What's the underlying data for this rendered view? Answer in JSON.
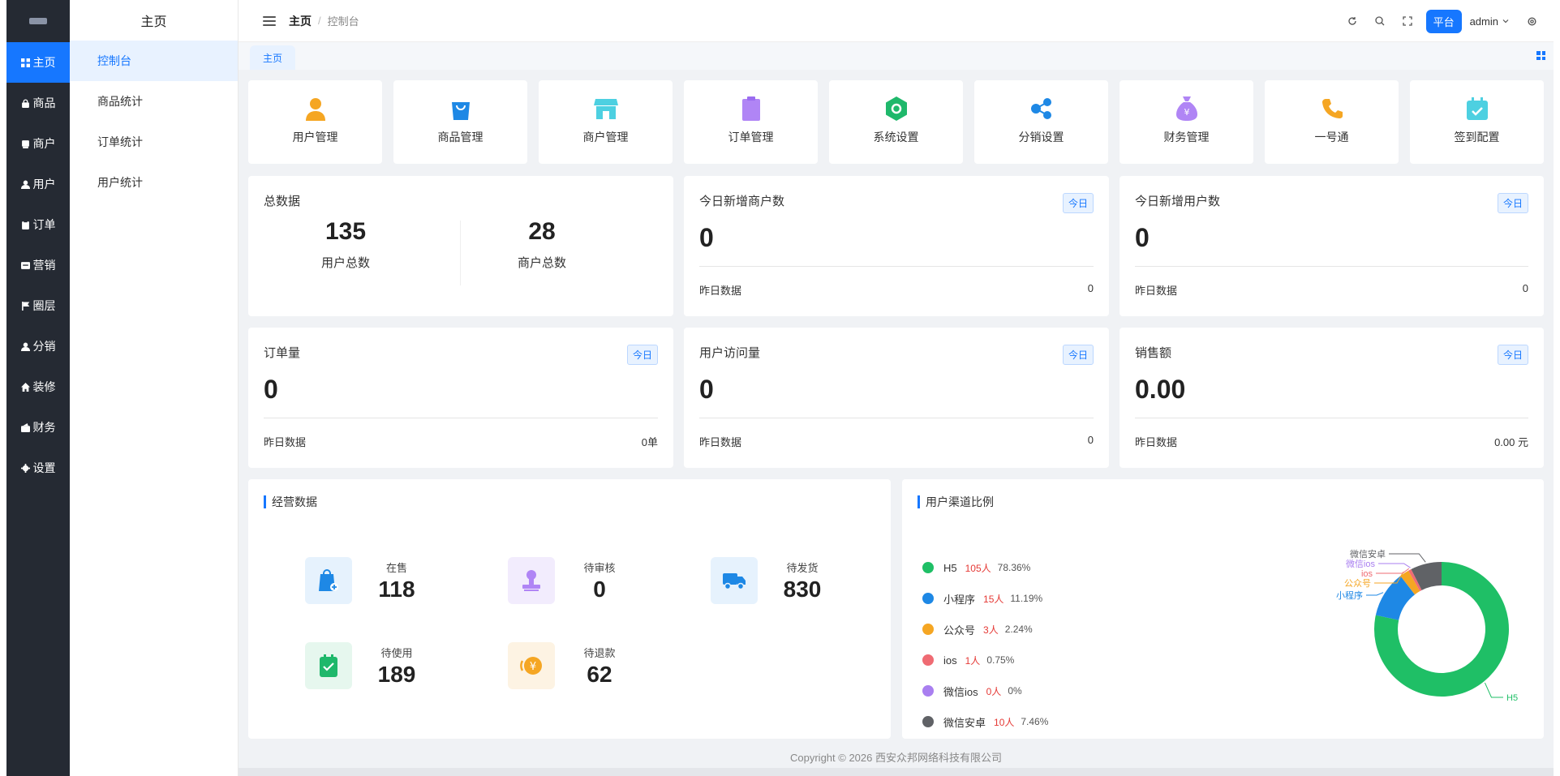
{
  "rail": {
    "items": [
      {
        "label": "主页",
        "icon": "grid-icon",
        "active": true
      },
      {
        "label": "商品",
        "icon": "lock-icon"
      },
      {
        "label": "商户",
        "icon": "shop-icon"
      },
      {
        "label": "用户",
        "icon": "user-icon"
      },
      {
        "label": "订单",
        "icon": "order-icon"
      },
      {
        "label": "营销",
        "icon": "marketing-icon"
      },
      {
        "label": "圈层",
        "icon": "flag-icon"
      },
      {
        "label": "分销",
        "icon": "distribution-icon"
      },
      {
        "label": "装修",
        "icon": "home-icon"
      },
      {
        "label": "财务",
        "icon": "finance-icon"
      },
      {
        "label": "设置",
        "icon": "gear-icon"
      }
    ]
  },
  "submenu": {
    "title": "主页",
    "items": [
      "控制台",
      "商品统计",
      "订单统计",
      "用户统计"
    ]
  },
  "topbar": {
    "breadcrumb_home": "主页",
    "breadcrumb_sep": "/",
    "breadcrumb_current": "控制台",
    "platform_label": "平台",
    "user": "admin"
  },
  "tabs": {
    "active": "主页"
  },
  "shortcuts": [
    {
      "label": "用户管理",
      "icon": "user-manage-icon",
      "color": "#f5a623"
    },
    {
      "label": "商品管理",
      "icon": "shopping-bag-icon",
      "color": "#1e88e5"
    },
    {
      "label": "商户管理",
      "icon": "storefront-icon",
      "color": "#4dd0e1"
    },
    {
      "label": "订单管理",
      "icon": "clipboard-icon",
      "color": "#b085f5"
    },
    {
      "label": "系统设置",
      "icon": "settings-hex-icon",
      "color": "#1fb86b"
    },
    {
      "label": "分销设置",
      "icon": "share-icon",
      "color": "#1e88e5"
    },
    {
      "label": "财务管理",
      "icon": "money-bag-icon",
      "color": "#b085f5"
    },
    {
      "label": "一号通",
      "icon": "phone-icon",
      "color": "#f5a623"
    },
    {
      "label": "签到配置",
      "icon": "calendar-check-icon",
      "color": "#4dd0e1"
    }
  ],
  "totals": {
    "title": "总数据",
    "users_value": "135",
    "users_label": "用户总数",
    "merchants_value": "28",
    "merchants_label": "商户总数"
  },
  "stats": [
    {
      "title": "今日新增商户数",
      "badge": "今日",
      "value": "0",
      "foot_label": "昨日数据",
      "foot_value": "0"
    },
    {
      "title": "今日新增用户数",
      "badge": "今日",
      "value": "0",
      "foot_label": "昨日数据",
      "foot_value": "0"
    },
    {
      "title": "订单量",
      "badge": "今日",
      "value": "0",
      "foot_label": "昨日数据",
      "foot_value": "0单"
    },
    {
      "title": "用户访问量",
      "badge": "今日",
      "value": "0",
      "foot_label": "昨日数据",
      "foot_value": "0"
    },
    {
      "title": "销售额",
      "badge": "今日",
      "value": "0.00",
      "foot_label": "昨日数据",
      "foot_value": "0.00 元"
    }
  ],
  "operations": {
    "title": "经营数据",
    "items": [
      {
        "label": "在售",
        "value": "118",
        "icon": "on-sale-icon",
        "color": "#1e88e5",
        "bg": "#e6f2fd"
      },
      {
        "label": "待审核",
        "value": "0",
        "icon": "stamp-icon",
        "color": "#b085f5",
        "bg": "#f2ecfd"
      },
      {
        "label": "待发货",
        "value": "830",
        "icon": "truck-icon",
        "color": "#1e88e5",
        "bg": "#e6f2fd"
      },
      {
        "label": "待使用",
        "value": "189",
        "icon": "checklist-icon",
        "color": "#1fb86b",
        "bg": "#e6f7ee"
      },
      {
        "label": "待退款",
        "value": "62",
        "icon": "refund-icon",
        "color": "#f5a623",
        "bg": "#fdf3e3"
      }
    ]
  },
  "channels": {
    "title": "用户渠道比例"
  },
  "chart_data": {
    "type": "pie",
    "donut": true,
    "categories": [
      "H5",
      "小程序",
      "公众号",
      "ios",
      "微信ios",
      "微信安卓"
    ],
    "values": [
      105,
      15,
      3,
      1,
      0,
      10
    ],
    "counts": [
      "105人",
      "15人",
      "3人",
      "1人",
      "0人",
      "10人"
    ],
    "percents": [
      "78.36%",
      "11.19%",
      "2.24%",
      "0.75%",
      "0%",
      "7.46%"
    ],
    "colors": [
      "#1fbf66",
      "#1e88e5",
      "#f5a623",
      "#ef6b73",
      "#a97ff0",
      "#606266"
    ],
    "legend_position": "left"
  },
  "footer": {
    "copyright": "Copyright © 2026 西安众邦网络科技有限公司"
  }
}
